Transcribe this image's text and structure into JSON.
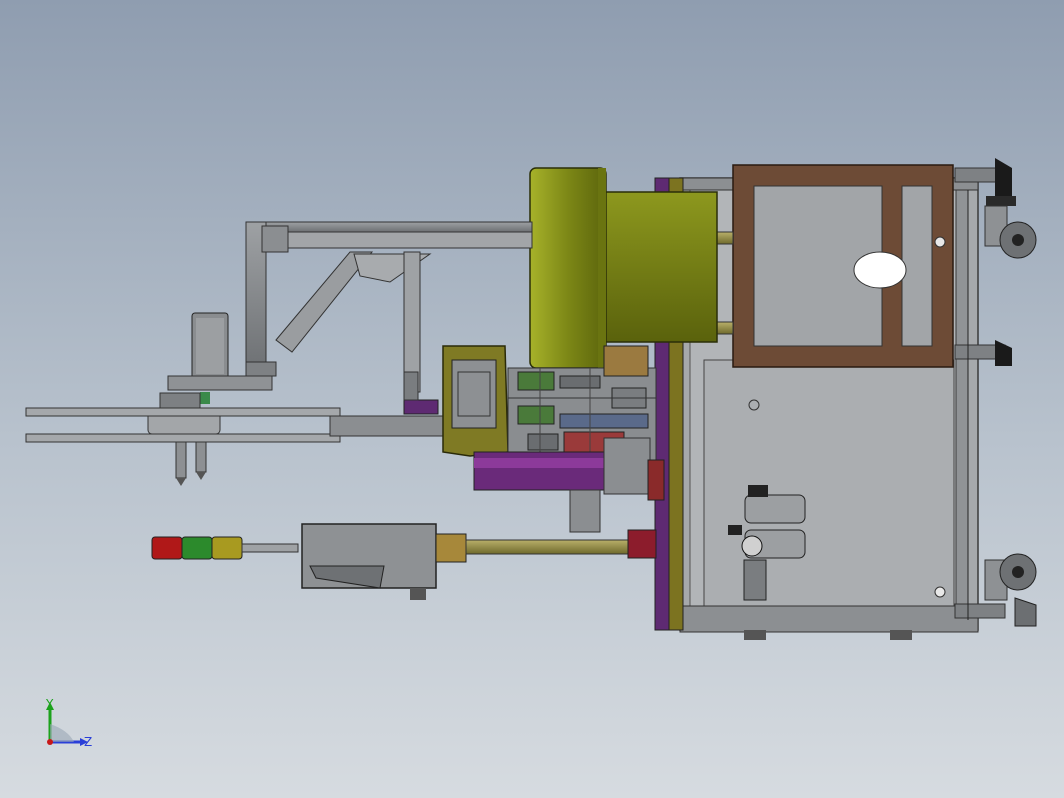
{
  "triad": {
    "y_label": "Y",
    "z_label": "Z",
    "colors": {
      "y": "#1ca21c",
      "z": "#2a3fd8",
      "x": "#c81818"
    }
  },
  "colors": {
    "background_top": "#8f9db0",
    "background_bottom": "#d6dbe0",
    "hopper_olive": "#7f8a16",
    "frame_brown": "#6a4a35",
    "frame_grey": "#8a8d90",
    "cabinet_grey": "#a4a7aa",
    "purple_plate": "#6a2a7a",
    "stack_light_red": "#b01818",
    "stack_light_green": "#2c8a2c",
    "stack_light_yellow": "#a89a20"
  }
}
